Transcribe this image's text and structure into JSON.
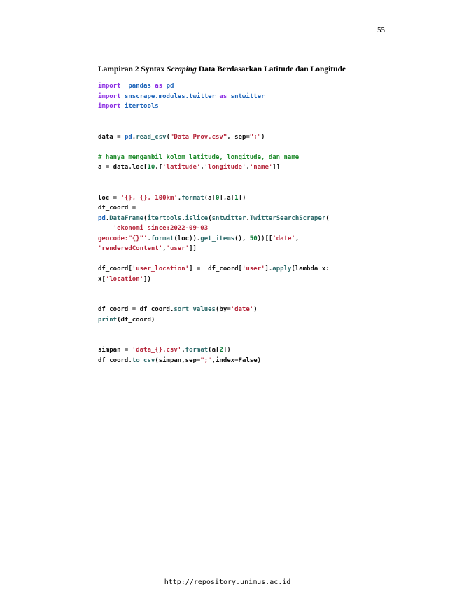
{
  "page_number": "55",
  "heading": {
    "prefix": "Lampiran 2 Syntax ",
    "italic": "Scraping",
    "suffix": " Data Berdasarkan Latitude dan Longitude"
  },
  "code_lines": [
    [
      [
        "kw",
        "import"
      ],
      [
        "",
        "  "
      ],
      [
        "mod",
        "pandas"
      ],
      [
        "",
        " "
      ],
      [
        "kw",
        "as"
      ],
      [
        "",
        " "
      ],
      [
        "mod",
        "pd"
      ]
    ],
    [
      [
        "kw",
        "import"
      ],
      [
        "",
        " "
      ],
      [
        "mod",
        "snscrape.modules.twitter"
      ],
      [
        "",
        " "
      ],
      [
        "kw",
        "as"
      ],
      [
        "",
        " "
      ],
      [
        "mod",
        "sntwitter"
      ]
    ],
    [
      [
        "kw",
        "import"
      ],
      [
        "",
        " "
      ],
      [
        "mod",
        "itertools"
      ]
    ],
    [],
    [],
    [
      [
        "",
        "data = "
      ],
      [
        "mod",
        "pd"
      ],
      [
        "",
        "."
      ],
      [
        "fn",
        "read_csv"
      ],
      [
        "",
        "("
      ],
      [
        "str",
        "\"Data Prov.csv\""
      ],
      [
        "",
        ", sep="
      ],
      [
        "str",
        "\";\""
      ],
      [
        "",
        ")"
      ]
    ],
    [],
    [
      [
        "cm",
        "# hanya mengambil kolom latitude, longitude, dan name"
      ]
    ],
    [
      [
        "",
        "a = data.loc["
      ],
      [
        "num",
        "10"
      ],
      [
        "",
        ",["
      ],
      [
        "str",
        "'latitude'"
      ],
      [
        "",
        ","
      ],
      [
        "str",
        "'longitude'"
      ],
      [
        "",
        ","
      ],
      [
        "str",
        "'name'"
      ],
      [
        "",
        "]]"
      ]
    ],
    [],
    [],
    [
      [
        "",
        "loc = "
      ],
      [
        "str",
        "'{}, {}, 100km'"
      ],
      [
        "",
        "."
      ],
      [
        "fn",
        "format"
      ],
      [
        "",
        "(a["
      ],
      [
        "num",
        "0"
      ],
      [
        "",
        "],a["
      ],
      [
        "num",
        "1"
      ],
      [
        "",
        "])"
      ]
    ],
    [
      [
        "",
        "df_coord ="
      ]
    ],
    [
      [
        "mod",
        "pd"
      ],
      [
        "",
        "."
      ],
      [
        "fn",
        "DataFrame"
      ],
      [
        "",
        "("
      ],
      [
        "fn",
        "itertools"
      ],
      [
        "",
        "."
      ],
      [
        "fn",
        "islice"
      ],
      [
        "",
        "("
      ],
      [
        "fn",
        "sntwitter"
      ],
      [
        "",
        "."
      ],
      [
        "fn",
        "TwitterSearchScraper"
      ],
      [
        "",
        "("
      ]
    ],
    [
      [
        "",
        "    "
      ],
      [
        "str",
        "'ekonomi since:2022-09-03"
      ]
    ],
    [
      [
        "str",
        "geocode:\"{}\"'"
      ],
      [
        "",
        "."
      ],
      [
        "fn",
        "format"
      ],
      [
        "",
        "(loc))."
      ],
      [
        "fn",
        "get_items"
      ],
      [
        "",
        "(), "
      ],
      [
        "num",
        "50"
      ],
      [
        "",
        "))[["
      ],
      [
        "str",
        "'date'"
      ],
      [
        "",
        ","
      ]
    ],
    [
      [
        "str",
        "'renderedContent'"
      ],
      [
        "",
        ","
      ],
      [
        "str",
        "'user'"
      ],
      [
        "",
        "]]"
      ]
    ],
    [],
    [
      [
        "",
        "df_coord["
      ],
      [
        "str",
        "'user_location'"
      ],
      [
        "",
        "] =  df_coord["
      ],
      [
        "str",
        "'user'"
      ],
      [
        "",
        "]."
      ],
      [
        "fn",
        "apply"
      ],
      [
        "",
        "(lambda x:"
      ]
    ],
    [
      [
        "",
        "x["
      ],
      [
        "str",
        "'location'"
      ],
      [
        "",
        "])"
      ]
    ],
    [],
    [],
    [
      [
        "",
        "df_coord = df_coord."
      ],
      [
        "fn",
        "sort_values"
      ],
      [
        "",
        "(by="
      ],
      [
        "str",
        "'date'"
      ],
      [
        "",
        ")"
      ]
    ],
    [
      [
        "fn",
        "print"
      ],
      [
        "",
        "(df_coord)"
      ]
    ],
    [],
    [],
    [
      [
        "",
        "simpan = "
      ],
      [
        "str",
        "'data_{}.csv'"
      ],
      [
        "",
        "."
      ],
      [
        "fn",
        "format"
      ],
      [
        "",
        "(a["
      ],
      [
        "num",
        "2"
      ],
      [
        "",
        "])"
      ]
    ],
    [
      [
        "",
        "df_coord."
      ],
      [
        "fn",
        "to_csv"
      ],
      [
        "",
        "(simpan,sep="
      ],
      [
        "str",
        "\";\""
      ],
      [
        "",
        ",index=False)"
      ]
    ]
  ],
  "footer": "http://repository.unimus.ac.id",
  "colors": {
    "keyword": "#8a2be2",
    "module": "#1a62b8",
    "function": "#2e6b6b",
    "string": "#b5263a",
    "number": "#0b7a35",
    "comment": "#1d8a2a"
  }
}
